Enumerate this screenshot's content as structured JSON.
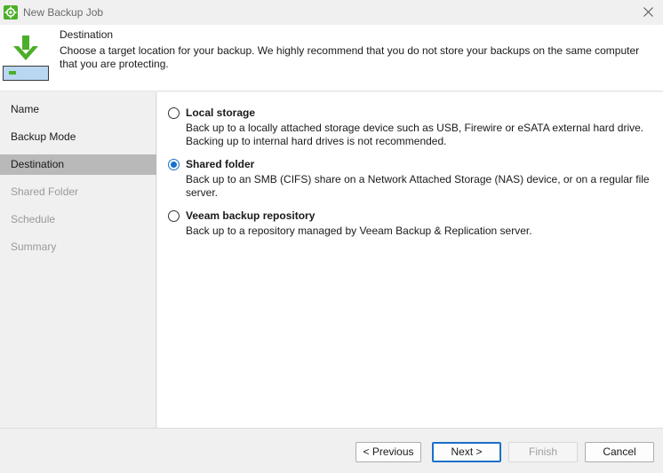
{
  "window": {
    "title": "New Backup Job"
  },
  "header": {
    "title": "Destination",
    "description": "Choose a target location for your backup. We highly recommend that you do not store your backups on the same computer that you are protecting."
  },
  "steps": [
    {
      "label": "Name",
      "state": "done"
    },
    {
      "label": "Backup Mode",
      "state": "done"
    },
    {
      "label": "Destination",
      "state": "active"
    },
    {
      "label": "Shared Folder",
      "state": "future"
    },
    {
      "label": "Schedule",
      "state": "future"
    },
    {
      "label": "Summary",
      "state": "future"
    }
  ],
  "options": [
    {
      "title": "Local storage",
      "description": "Back up to a locally attached storage device such as USB, Firewire or eSATA external hard drive. Backing up to internal hard drives is not recommended.",
      "selected": false
    },
    {
      "title": "Shared folder",
      "description": "Back up to an SMB (CIFS) share on a Network Attached Storage (NAS) device, or on a regular file server.",
      "selected": true
    },
    {
      "title": "Veeam backup repository",
      "description": "Back up to a repository managed by Veeam Backup & Replication server.",
      "selected": false
    }
  ],
  "buttons": {
    "previous": "< Previous",
    "next": "Next >",
    "finish": "Finish",
    "cancel": "Cancel"
  },
  "colors": {
    "accent": "#1a6fc9",
    "icon_green": "#4caf2a",
    "active_step_bg": "#b9b9b9"
  }
}
